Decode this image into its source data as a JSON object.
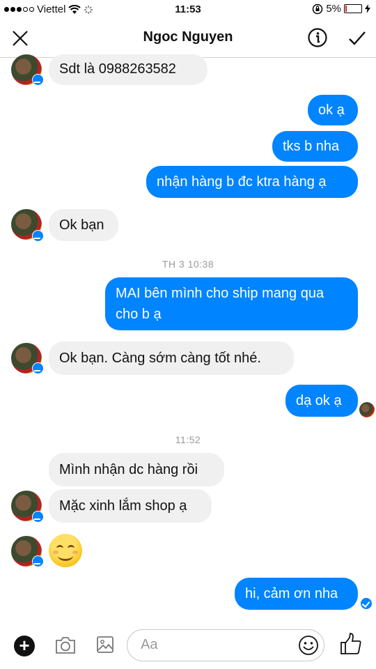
{
  "status_bar": {
    "carrier": "Viettel",
    "time": "11:53",
    "battery": "5%",
    "battery_level": 0.05
  },
  "header": {
    "title": "Ngoc Nguyen"
  },
  "messages": [
    {
      "side": "in",
      "text": "Sdt là 0988263582"
    },
    {
      "side": "out",
      "text": "ok ạ"
    },
    {
      "side": "out",
      "text": "tks b nha"
    },
    {
      "side": "out",
      "text": "nhận hàng b đc ktra hàng ạ"
    },
    {
      "side": "in",
      "text": "Ok bạn"
    },
    {
      "side": "stamp",
      "text": "TH 3 10:38"
    },
    {
      "side": "out",
      "text_line1": "MAI bên mình cho ship mang qua",
      "text_line2": "cho b ạ"
    },
    {
      "side": "in",
      "text": "Ok bạn. Càng sớm càng tốt nhé."
    },
    {
      "side": "out",
      "text": "dạ ok ạ"
    },
    {
      "side": "stamp",
      "text": "11:52"
    },
    {
      "side": "in",
      "text": "Mình nhận dc hàng rồi"
    },
    {
      "side": "in",
      "text": "Mặc xinh lắm shop ạ"
    },
    {
      "side": "in",
      "emoji": "smiling-face-emoji"
    },
    {
      "side": "out",
      "text": "hi, cảm ơn nha"
    }
  ],
  "composer": {
    "placeholder": "Aa",
    "icons": [
      "plus-icon",
      "camera-icon",
      "image-icon",
      "emoji-icon",
      "thumbs-up-icon"
    ]
  },
  "colors": {
    "accent": "#0084ff",
    "incoming_bubble": "#f1f0f0",
    "battery_low": "#e02020"
  }
}
